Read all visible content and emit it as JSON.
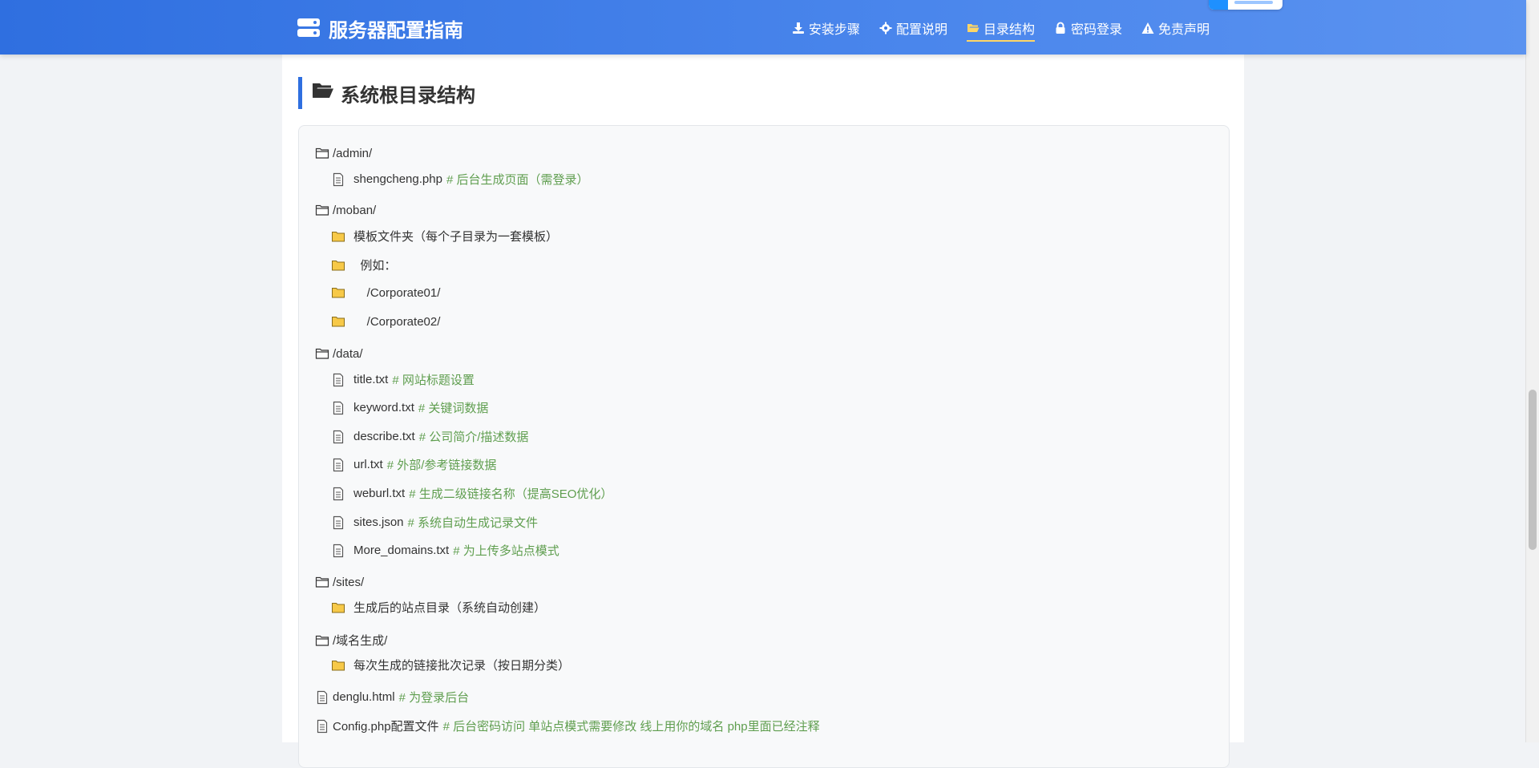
{
  "header": {
    "brand": "服务器配置指南",
    "brand_icon": "server-icon",
    "nav": [
      {
        "label": "安装步骤",
        "icon": "download-icon",
        "active": false
      },
      {
        "label": "配置说明",
        "icon": "gear-icon",
        "active": false
      },
      {
        "label": "目录结构",
        "icon": "folder-open-icon",
        "active": true
      },
      {
        "label": "密码登录",
        "icon": "lock-icon",
        "active": false
      },
      {
        "label": "免责声明",
        "icon": "warning-icon",
        "active": false
      }
    ]
  },
  "section": {
    "title": "系统根目录结构",
    "icon": "folder-open-icon"
  },
  "tree": [
    {
      "type": "folder",
      "name": "/admin/",
      "children": [
        {
          "type": "file",
          "name": "shengcheng.php",
          "comment": "# 后台生成页面（需登录）"
        }
      ]
    },
    {
      "type": "folder",
      "name": "/moban/",
      "children": [
        {
          "type": "folder",
          "name": "模板文件夹（每个子目录为一套模板）"
        },
        {
          "type": "folder",
          "name": "  例如："
        },
        {
          "type": "folder",
          "name": "    /Corporate01/"
        },
        {
          "type": "folder",
          "name": "    /Corporate02/"
        }
      ]
    },
    {
      "type": "folder",
      "name": "/data/",
      "children": [
        {
          "type": "file",
          "name": "title.txt",
          "comment": "# 网站标题设置"
        },
        {
          "type": "file",
          "name": "keyword.txt",
          "comment": "# 关键词数据"
        },
        {
          "type": "file",
          "name": "describe.txt",
          "comment": "# 公司简介/描述数据"
        },
        {
          "type": "file",
          "name": "url.txt",
          "comment": "# 外部/参考链接数据"
        },
        {
          "type": "file",
          "name": "weburl.txt",
          "comment": "# 生成二级链接名称（提高SEO优化）"
        },
        {
          "type": "file",
          "name": "sites.json",
          "comment": "# 系统自动生成记录文件"
        },
        {
          "type": "file",
          "name": "More_domains.txt",
          "comment": "# 为上传多站点模式"
        }
      ]
    },
    {
      "type": "folder",
      "name": "/sites/",
      "children": [
        {
          "type": "folder",
          "name": "生成后的站点目录（系统自动创建）"
        }
      ]
    },
    {
      "type": "folder",
      "name": "/域名生成/",
      "children": [
        {
          "type": "folder",
          "name": "每次生成的链接批次记录（按日期分类）"
        }
      ]
    },
    {
      "type": "file",
      "name": "denglu.html",
      "comment": "# 为登录后台"
    },
    {
      "type": "file",
      "name": "Config.php配置文件",
      "comment": "# 后台密码访问 单站点模式需要修改 线上用你的域名 php里面已经注释"
    }
  ],
  "colors": {
    "accent": "#2f6fe0",
    "comment": "#5f9e4f",
    "folder": "#f0c14b",
    "active_underline": "#ffd666"
  }
}
